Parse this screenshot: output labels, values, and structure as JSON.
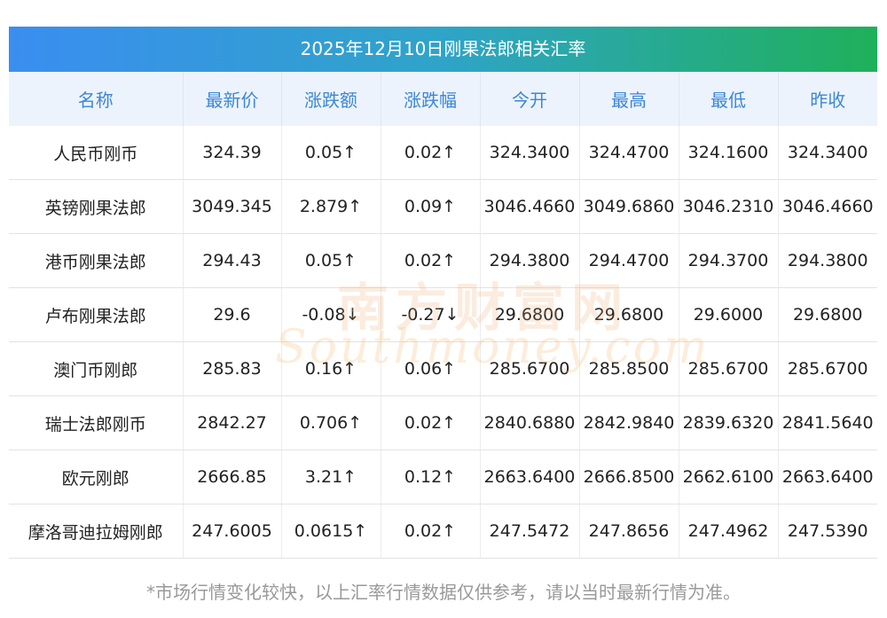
{
  "title": "2025年12月10日刚果法郎相关汇率",
  "colors": {
    "title_gradient_start": "#3a8ef0",
    "title_gradient_end": "#1fb05a",
    "header_text": "#3b87d6",
    "header_bg": "#edf3fc",
    "up": "#e5242b",
    "down": "#1f8a1f"
  },
  "columns": [
    "名称",
    "最新价",
    "涨跌额",
    "涨跌幅",
    "今开",
    "最高",
    "最低",
    "昨收"
  ],
  "rows": [
    {
      "name": "人民币刚币",
      "price": "324.39",
      "change": "0.05↑",
      "change_pct": "0.02↑",
      "open": "324.3400",
      "high": "324.4700",
      "low": "324.1600",
      "prev_close": "324.3400",
      "direction": "up"
    },
    {
      "name": "英镑刚果法郎",
      "price": "3049.345",
      "change": "2.879↑",
      "change_pct": "0.09↑",
      "open": "3046.4660",
      "high": "3049.6860",
      "low": "3046.2310",
      "prev_close": "3046.4660",
      "direction": "up"
    },
    {
      "name": "港币刚果法郎",
      "price": "294.43",
      "change": "0.05↑",
      "change_pct": "0.02↑",
      "open": "294.3800",
      "high": "294.4700",
      "low": "294.3700",
      "prev_close": "294.3800",
      "direction": "up"
    },
    {
      "name": "卢布刚果法郎",
      "price": "29.6",
      "change": "-0.08↓",
      "change_pct": "-0.27↓",
      "open": "29.6800",
      "high": "29.6800",
      "low": "29.6000",
      "prev_close": "29.6800",
      "direction": "down"
    },
    {
      "name": "澳门币刚郎",
      "price": "285.83",
      "change": "0.16↑",
      "change_pct": "0.06↑",
      "open": "285.6700",
      "high": "285.8500",
      "low": "285.6700",
      "prev_close": "285.6700",
      "direction": "up"
    },
    {
      "name": "瑞士法郎刚币",
      "price": "2842.27",
      "change": "0.706↑",
      "change_pct": "0.02↑",
      "open": "2840.6880",
      "high": "2842.9840",
      "low": "2839.6320",
      "prev_close": "2841.5640",
      "direction": "up"
    },
    {
      "name": "欧元刚郎",
      "price": "2666.85",
      "change": "3.21↑",
      "change_pct": "0.12↑",
      "open": "2663.6400",
      "high": "2666.8500",
      "low": "2662.6100",
      "prev_close": "2663.6400",
      "direction": "up"
    },
    {
      "name": "摩洛哥迪拉姆刚郎",
      "price": "247.6005",
      "change": "0.0615↑",
      "change_pct": "0.02↑",
      "open": "247.5472",
      "high": "247.8656",
      "low": "247.4962",
      "prev_close": "247.5390",
      "direction": "up"
    }
  ],
  "watermark": {
    "cn": "南方财富网",
    "en": "Southmoney.com"
  },
  "footnote": "*市场行情变化较快，以上汇率行情数据仅供参考，请以当时最新行情为准。"
}
